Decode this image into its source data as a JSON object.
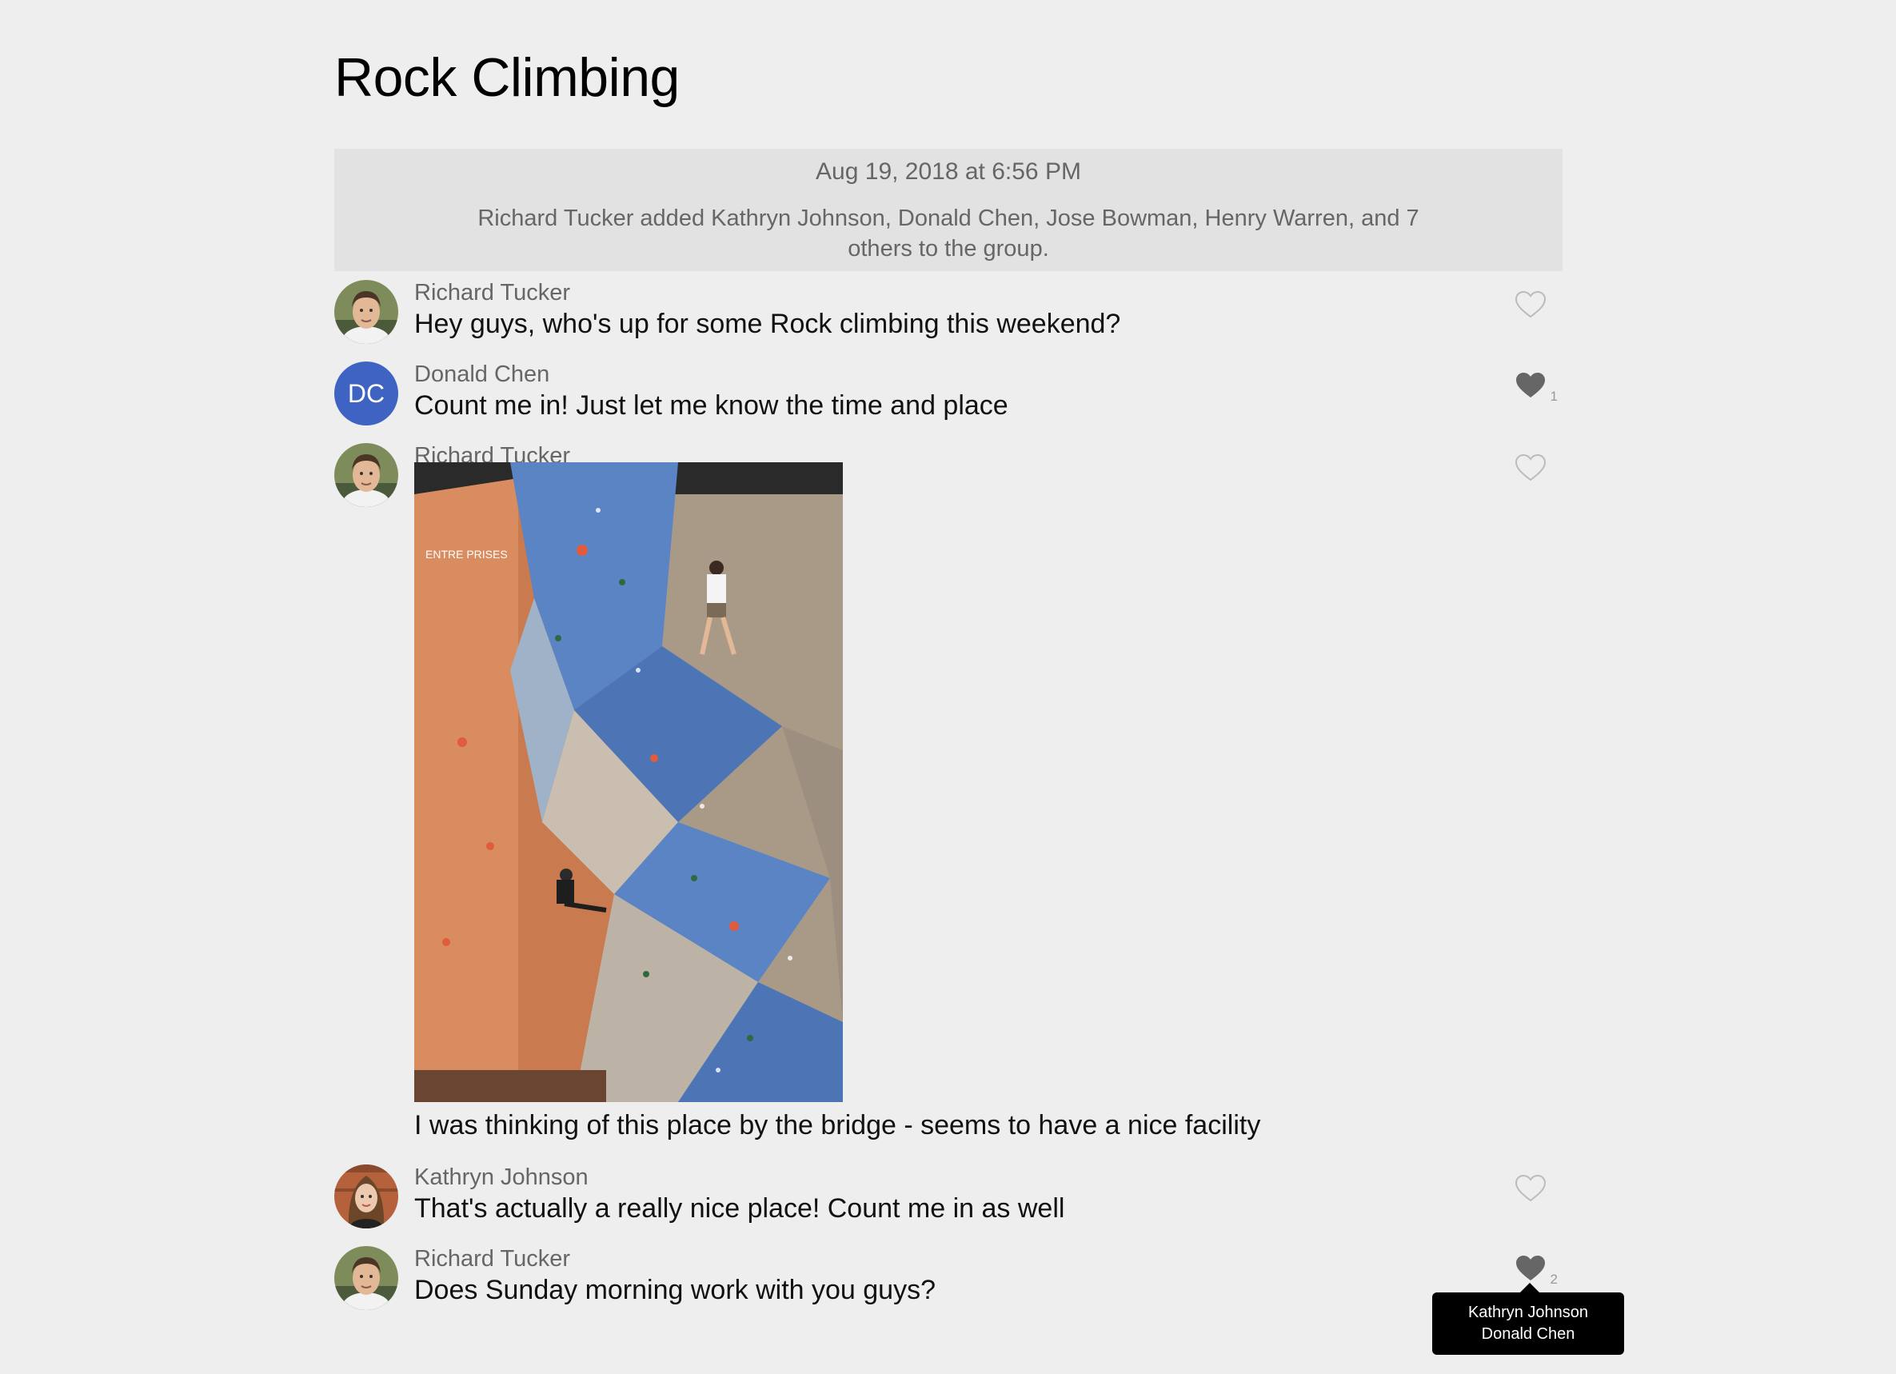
{
  "group": {
    "title": "Rock Climbing"
  },
  "system_message": {
    "date": "Aug 19, 2018 at 6:56 PM",
    "text": "Richard Tucker added Kathryn Johnson, Donald Chen, Jose Bowman, Henry Warren, and 7 others to the group."
  },
  "messages": [
    {
      "author": "Richard Tucker",
      "text": "Hey guys, who's up for some Rock climbing this weekend?",
      "liked": false,
      "likes": ""
    },
    {
      "author": "Donald Chen",
      "initials": "DC",
      "text": "Count me in! Just let me know the time and place",
      "liked": true,
      "likes": "1"
    },
    {
      "author": "Richard Tucker",
      "text": "I was thinking of this place by the bridge - seems to have a nice facility",
      "liked": false,
      "likes": "",
      "has_image": true
    },
    {
      "author": "Kathryn Johnson",
      "text": "That's actually a really nice place! Count me in as well",
      "liked": false,
      "likes": ""
    },
    {
      "author": "Richard Tucker",
      "text": "Does Sunday morning work with you guys?",
      "liked": true,
      "likes": "2"
    }
  ],
  "tooltip": {
    "line1": "Kathryn Johnson",
    "line2": "Donald Chen"
  },
  "colors": {
    "background": "#eeeeee",
    "system_box": "#e2e2e2",
    "avatar_dc": "#3e63c2",
    "heart_filled": "#666666",
    "heart_outline": "#bbbbbb"
  }
}
